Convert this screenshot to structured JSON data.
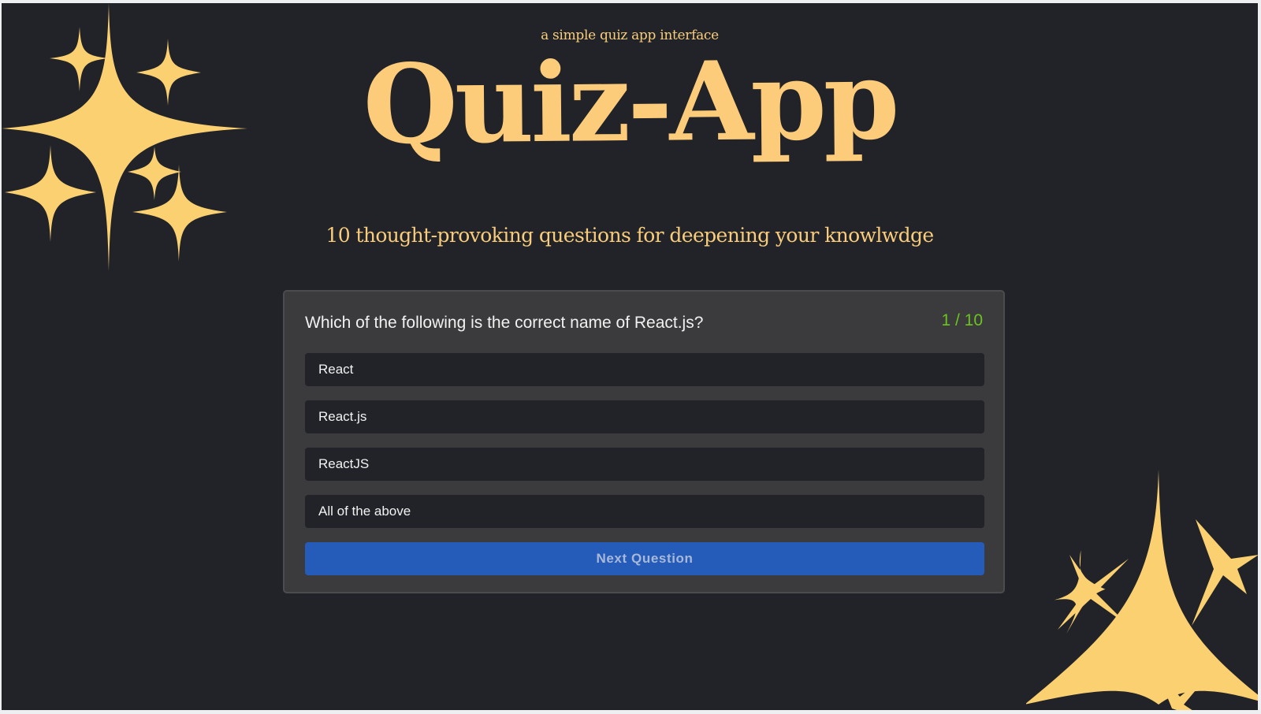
{
  "header": {
    "tagline": "a simple quiz app interface",
    "title": "Quiz-App",
    "subtitle": "10 thought-provoking questions for deepening your knowlwdge"
  },
  "quiz": {
    "question": "Which of the following is the correct name of React.js?",
    "counter": "1 / 10",
    "options": [
      {
        "label": "React"
      },
      {
        "label": "React.js"
      },
      {
        "label": "ReactJS"
      },
      {
        "label": "All of the above"
      }
    ],
    "next_label": "Next Question"
  },
  "decorations": {
    "top_left": "sparkles-icon",
    "bottom_right": "sparkles-icon"
  },
  "colors": {
    "background": "#212328",
    "accent_gold": "#fdcc7a",
    "card": "#3b3b3d",
    "option": "#212328",
    "counter_green": "#6bc41d",
    "button_blue": "#255cba"
  }
}
